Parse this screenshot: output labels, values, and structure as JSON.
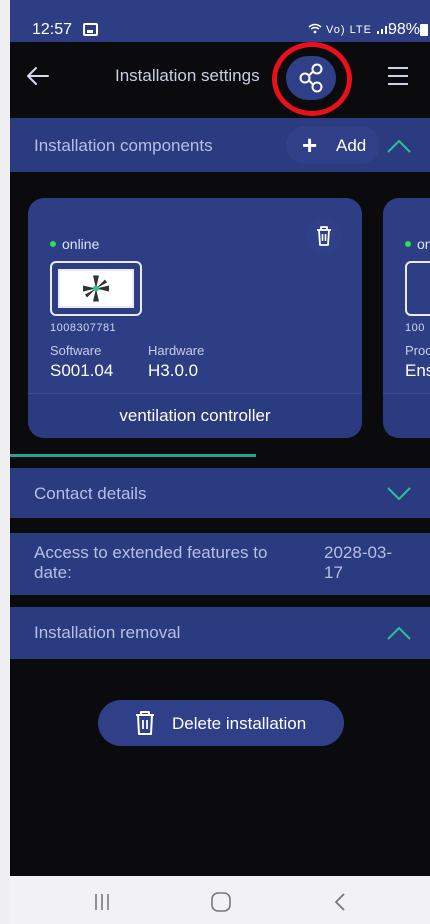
{
  "status_bar": {
    "time": "12:57",
    "signal_text": "Vo) LTE",
    "battery": "98%"
  },
  "header": {
    "title": "Installation settings"
  },
  "components": {
    "label": "Installation components",
    "add_label": "Add",
    "cards": [
      {
        "status": "online",
        "serial": "1008307781",
        "software_label": "Software",
        "software_value": "S001.04",
        "hardware_label": "Hardware",
        "hardware_value": "H3.0.0",
        "name": "ventilation controller"
      },
      {
        "status": "on",
        "serial": "100",
        "label": "Proc",
        "value": "Ens"
      }
    ]
  },
  "contact": {
    "label": "Contact details"
  },
  "access": {
    "label_line1": "Access to extended features to",
    "label_line2": "date:",
    "date_line1": "2028-03-",
    "date_line2": "17"
  },
  "removal": {
    "label": "Installation removal",
    "delete_label": "Delete installation"
  },
  "colors": {
    "accent_blue": "#2d3e84",
    "online_green": "#2ee051",
    "highlight_red": "#e8101b",
    "chevron_green": "#2dbf98"
  }
}
